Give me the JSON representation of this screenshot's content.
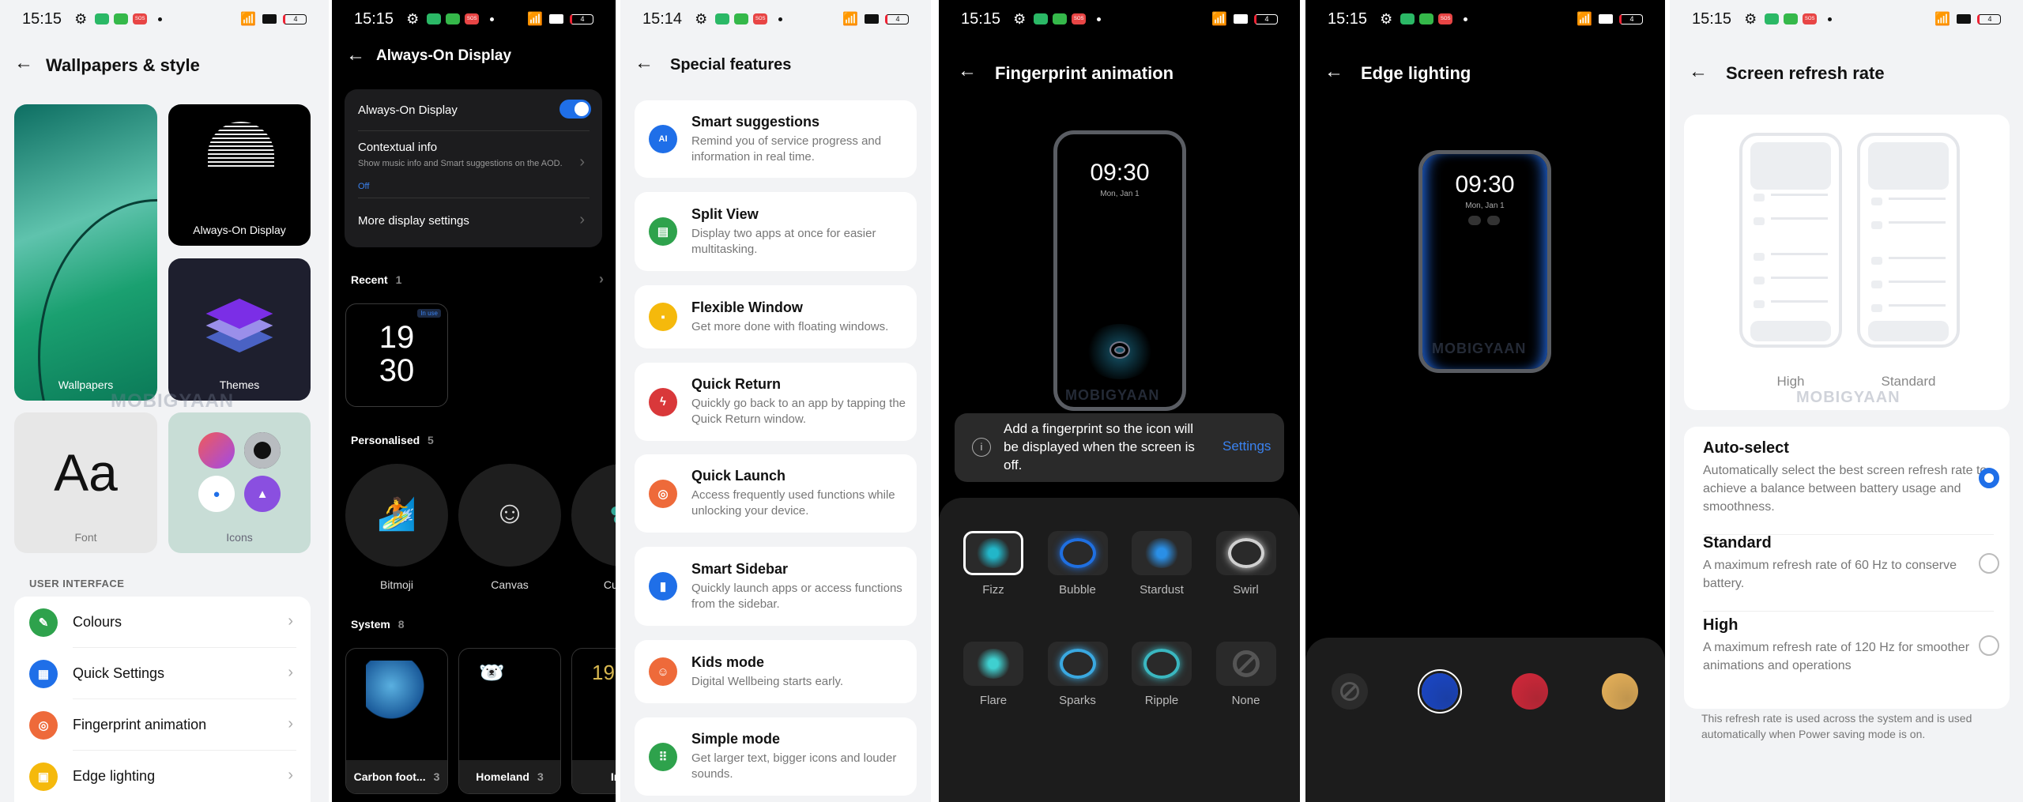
{
  "status": {
    "battery": "4",
    "sos": "SOS"
  },
  "watermark": "MOBIGYAAN",
  "wallpapers": {
    "time": "15:15",
    "title": "Wallpapers & style",
    "tiles": {
      "wallpapers": "Wallpapers",
      "aod": "Always-On Display",
      "themes": "Themes",
      "font_sample": "Aa",
      "font": "Font",
      "icons": "Icons"
    },
    "section": "USER INTERFACE",
    "items": [
      {
        "label": "Colours",
        "icon": "brush-icon",
        "color": "#2ea24c",
        "glyph": "✎"
      },
      {
        "label": "Quick Settings",
        "icon": "quick-settings-icon",
        "color": "#1f6fe8",
        "glyph": "▦"
      },
      {
        "label": "Fingerprint animation",
        "icon": "fingerprint-icon",
        "color": "#ee6a3a",
        "glyph": "◎"
      },
      {
        "label": "Edge lighting",
        "icon": "edge-lighting-icon",
        "color": "#f5b90c",
        "glyph": "▣"
      }
    ]
  },
  "aod": {
    "time": "15:15",
    "title": "Always-On Display",
    "toggle_label": "Always-On Display",
    "toggle_on": true,
    "contextual": {
      "title": "Contextual info",
      "desc": "Show music info and Smart suggestions on the AOD.",
      "value": "Off"
    },
    "more": "More display settings",
    "recent": {
      "label": "Recent",
      "count": "1",
      "badge": "In use",
      "clock_h": "19",
      "clock_m": "30"
    },
    "personalised": {
      "label": "Personalised",
      "count": "5",
      "items": [
        "Bitmoji",
        "Canvas",
        "Custom"
      ]
    },
    "system": {
      "label": "System",
      "count": "8",
      "items": [
        {
          "name": "Carbon foot...",
          "count": "3"
        },
        {
          "name": "Homeland",
          "count": "3"
        },
        {
          "name": "Ins",
          "count": ""
        }
      ]
    }
  },
  "special": {
    "time": "15:14",
    "title": "Special features",
    "items": [
      {
        "title": "Smart suggestions",
        "desc": "Remind you of service progress and information in real time.",
        "icon": "ai-icon",
        "color": "#1f6fe8",
        "glyph": "AI"
      },
      {
        "title": "Split View",
        "desc": "Display two apps at once for easier multitasking.",
        "icon": "split-view-icon",
        "color": "#2ea24c",
        "glyph": "▤"
      },
      {
        "title": "Flexible Window",
        "desc": "Get more done with floating windows.",
        "icon": "flexible-window-icon",
        "color": "#f5b90c",
        "glyph": "▪"
      },
      {
        "title": "Quick Return",
        "desc": "Quickly go back to an app by tapping the Quick Return window.",
        "icon": "quick-return-icon",
        "color": "#d9383a",
        "glyph": "ϟ"
      },
      {
        "title": "Quick Launch",
        "desc": "Access frequently used functions while unlocking your device.",
        "icon": "quick-launch-icon",
        "color": "#ee6a3a",
        "glyph": "◎"
      },
      {
        "title": "Smart Sidebar",
        "desc": "Quickly launch apps or access functions from the sidebar.",
        "icon": "sidebar-icon",
        "color": "#1f6fe8",
        "glyph": "▮"
      },
      {
        "title": "Kids mode",
        "desc": "Digital Wellbeing starts early.",
        "icon": "kids-mode-icon",
        "color": "#ee6a3a",
        "glyph": "☺"
      },
      {
        "title": "Simple mode",
        "desc": "Get larger text, bigger icons and louder sounds.",
        "icon": "simple-mode-icon",
        "color": "#2ea24c",
        "glyph": "⠿"
      }
    ]
  },
  "fingerprint": {
    "time": "15:15",
    "title": "Fingerprint animation",
    "preview": {
      "clock": "09:30",
      "date": "Mon, Jan 1"
    },
    "banner": {
      "text": "Add a fingerprint so the icon will be displayed when the screen is off.",
      "action": "Settings"
    },
    "selected": "Fizz",
    "items": [
      {
        "name": "Fizz",
        "color": "#22b6c9"
      },
      {
        "name": "Bubble",
        "color": "#1f6fe0"
      },
      {
        "name": "Stardust",
        "color": "#2a8fe6"
      },
      {
        "name": "Swirl",
        "color": "#d0d0d0"
      },
      {
        "name": "Flare",
        "color": "#3fd0d0"
      },
      {
        "name": "Sparks",
        "color": "#3aa8e0"
      },
      {
        "name": "Ripple",
        "color": "#3ab7c0"
      },
      {
        "name": "None",
        "color": "#555555"
      }
    ]
  },
  "edge": {
    "time": "15:15",
    "title": "Edge lighting",
    "preview": {
      "clock": "09:30",
      "date": "Mon, Jan 1"
    },
    "selected_index": 1,
    "colors": [
      {
        "name": "none",
        "hex": "#2b2b2b"
      },
      {
        "name": "blue",
        "hex": "#1a47c8"
      },
      {
        "name": "red",
        "hex": "#d3283a"
      },
      {
        "name": "gold",
        "hex": "#e9b35a"
      }
    ]
  },
  "refresh": {
    "time": "15:15",
    "title": "Screen refresh rate",
    "preview_labels": [
      "High",
      "Standard"
    ],
    "selected": "Auto-select",
    "options": [
      {
        "title": "Auto-select",
        "desc": "Automatically select the best screen refresh rate to achieve a balance between battery usage and smoothness."
      },
      {
        "title": "Standard",
        "desc": "A maximum refresh rate of 60 Hz to conserve battery."
      },
      {
        "title": "High",
        "desc": "A maximum refresh rate of 120 Hz for smoother animations and operations"
      }
    ],
    "footer": "This refresh rate is used across the system and is used automatically when Power saving mode is on."
  }
}
